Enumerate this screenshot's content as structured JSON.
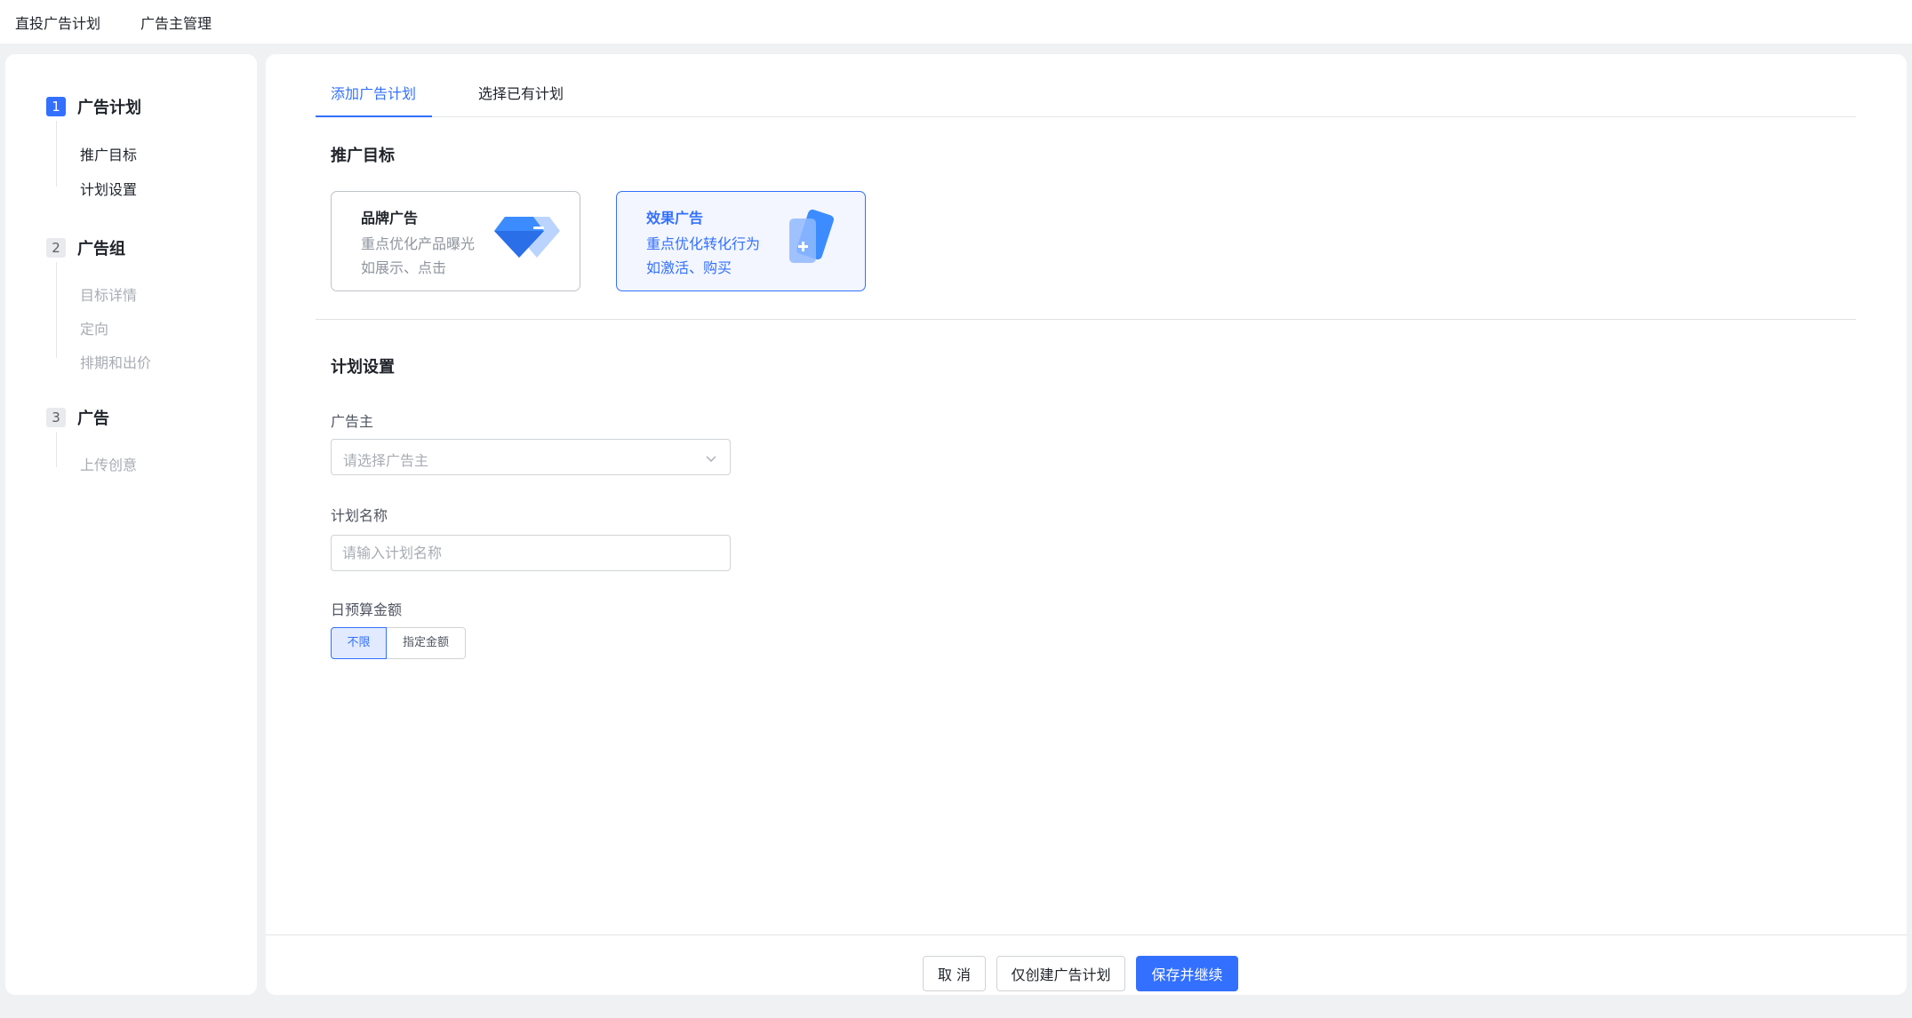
{
  "topnav": {
    "items": [
      "直投广告计划",
      "广告主管理"
    ]
  },
  "steps": [
    {
      "num": "1",
      "title": "广告计划",
      "subitems": [
        "推广目标",
        "计划设置"
      ]
    },
    {
      "num": "2",
      "title": "广告组",
      "subitems": [
        "目标详情",
        "定向",
        "排期和出价"
      ]
    },
    {
      "num": "3",
      "title": "广告",
      "subitems": [
        "上传创意"
      ]
    }
  ],
  "tabs": [
    "添加广告计划",
    "选择已有计划"
  ],
  "objective": {
    "title": "推广目标",
    "cards": [
      {
        "title": "品牌广告",
        "line1": "重点优化产品曝光",
        "line2": "如展示、点击",
        "icon": "diamond-icon"
      },
      {
        "title": "效果广告",
        "line1": "重点优化转化行为",
        "line2": "如激活、购买",
        "icon": "card-plus-icon"
      }
    ]
  },
  "plan": {
    "title": "计划设置",
    "advertiser_label": "广告主",
    "advertiser_placeholder": "请选择广告主",
    "name_label": "计划名称",
    "name_placeholder": "请输入计划名称",
    "budget_label": "日预算金额",
    "budget_options": [
      "不限",
      "指定金额"
    ],
    "budget_selected": "不限"
  },
  "footer": {
    "cancel": "取 消",
    "create_only": "仅创建广告计划",
    "save_continue": "保存并继续"
  },
  "colors": {
    "accent": "#3370ff",
    "selected_bg": "#f3f6ff",
    "page_bg": "#f0f1f3"
  }
}
